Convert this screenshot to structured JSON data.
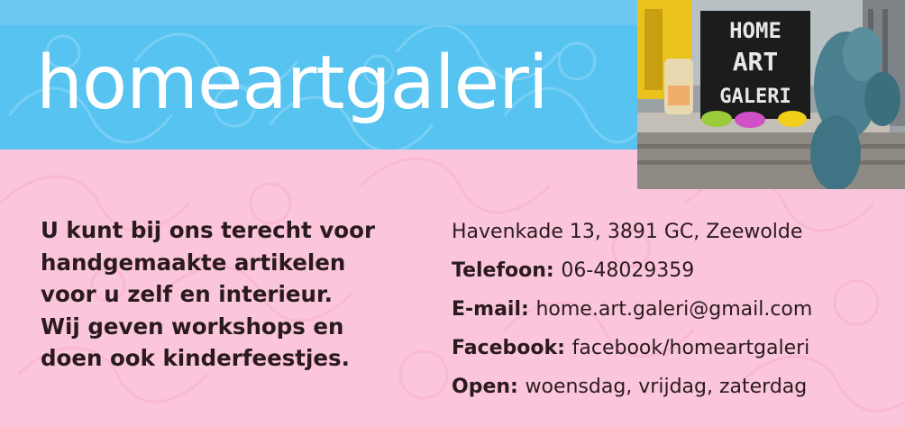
{
  "brand": {
    "name": "homeartgaleri"
  },
  "tagline": {
    "lines": [
      "U kunt bij ons terecht voor",
      "handgemaakte artikelen",
      "voor u zelf  en interieur.",
      "Wij geven workshops en",
      "doen ook kinderfeestjes."
    ]
  },
  "contact": {
    "address": "Havenkade 13, 3891 GC, Zeewolde",
    "phone_label": "Telefoon:",
    "phone": "06-48029359",
    "email_label": "E-mail:",
    "email": "home.art.galeri@gmail.com",
    "facebook_label": "Facebook:",
    "facebook": "facebook/homeartgaleri",
    "open_label": "Open:",
    "open": "woensdag, vrijdag, zaterdag"
  },
  "photo": {
    "sign_lines": [
      "HOME",
      "ART",
      "GALERI"
    ]
  },
  "colors": {
    "blue": "#57c3f0",
    "pink": "#fbc6dc",
    "text": "#2a1a1e",
    "white": "#ffffff"
  }
}
